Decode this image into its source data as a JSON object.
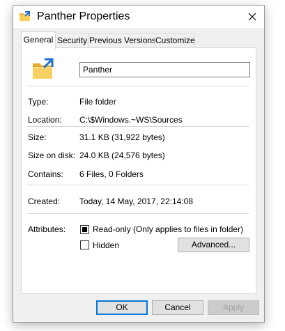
{
  "window": {
    "title": "Panther Properties",
    "title_icon": "folder-icon"
  },
  "tabs": [
    {
      "label": "General",
      "active": true
    },
    {
      "label": "Security",
      "active": false
    },
    {
      "label": "Previous Versions",
      "active": false
    },
    {
      "label": "Customize",
      "active": false
    }
  ],
  "general": {
    "name_value": "Panther",
    "type_label": "Type:",
    "type_value": "File folder",
    "location_label": "Location:",
    "location_value": "C:\\$Windows.~WS\\Sources",
    "size_label": "Size:",
    "size_value": "31.1 KB (31,922 bytes)",
    "size_on_disk_label": "Size on disk:",
    "size_on_disk_value": "24.0 KB (24,576 bytes)",
    "contains_label": "Contains:",
    "contains_value": "6 Files, 0 Folders",
    "created_label": "Created:",
    "created_value": "Today, 14 May, 2017, 22:14:08",
    "attributes_label": "Attributes:",
    "readonly_label": "Read-only (Only applies to files in folder)",
    "readonly_state": "indeterminate",
    "hidden_label": "Hidden",
    "hidden_checked": false,
    "advanced_label": "Advanced..."
  },
  "footer": {
    "ok_label": "OK",
    "cancel_label": "Cancel",
    "apply_label": "Apply"
  },
  "colors": {
    "accent": "#0078d7",
    "folder_yellow": "#f3c84b",
    "shortcut_blue": "#1e6fd0"
  }
}
